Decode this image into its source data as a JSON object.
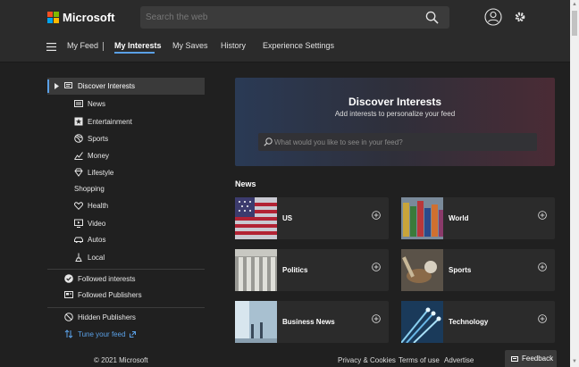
{
  "header": {
    "brand": "Microsoft",
    "search_placeholder": "Search the web"
  },
  "nav": {
    "items": [
      "My Feed",
      "My Interests",
      "My Saves",
      "History",
      "Experience Settings"
    ],
    "active": "My Interests"
  },
  "sidebar": {
    "heading": "Discover Interests",
    "items": [
      "News",
      "Entertainment",
      "Sports",
      "Money",
      "Lifestyle",
      "Shopping",
      "Health",
      "Video",
      "Autos",
      "Local"
    ],
    "followed_interests": "Followed interests",
    "followed_publishers": "Followed Publishers",
    "hidden_publishers": "Hidden Publishers",
    "tune_feed": "Tune your feed"
  },
  "hero": {
    "title": "Discover Interests",
    "subtitle": "Add interests to personalize your feed",
    "search_placeholder": "What would you like to see in your feed?"
  },
  "news": {
    "title": "News",
    "cards": [
      "US",
      "World",
      "Politics",
      "Sports",
      "Business News",
      "Technology"
    ]
  },
  "footer": {
    "copyright": "© 2021 Microsoft",
    "privacy": "Privacy & Cookies",
    "terms": "Terms of use",
    "advertise": "Advertise",
    "feedback": "Feedback"
  },
  "colors": {
    "accent": "#5aa0e6",
    "background": "#202020",
    "panel": "#2b2b2b"
  }
}
